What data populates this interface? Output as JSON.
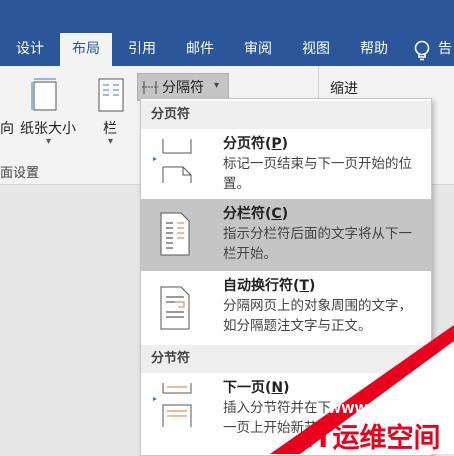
{
  "tabs": [
    "设计",
    "布局",
    "引用",
    "邮件",
    "审阅",
    "视图",
    "帮助",
    "告"
  ],
  "ribbon": {
    "orientation_partial": "向",
    "size": "纸张大小",
    "columns": "栏",
    "breaks_button": "分隔符",
    "indent": "缩进",
    "group_label": "面设置"
  },
  "menu": {
    "page_breaks_header": "分页符",
    "section_breaks_header": "分节符",
    "items": [
      {
        "title": "分页符(",
        "key": "P",
        "desc": "标记一页结束与下一页开始的位置。"
      },
      {
        "title": "分栏符(",
        "key": "C",
        "desc": "指示分栏符后面的文字将从下一栏开始。"
      },
      {
        "title": "自动换行符(",
        "key": "T",
        "desc": "分隔网页上的对象周围的文字，如分隔题注文字与正文。"
      },
      {
        "title": "下一页(",
        "key": "N",
        "desc": "插入分节符并在下一页上开始新节。"
      }
    ]
  },
  "watermark": {
    "url": "WWW.94IP.COM",
    "text": "IT运维空间"
  },
  "colors": {
    "ribbon_blue": "#2b579a",
    "hover": "#c5c5c5",
    "watermark_red": "#e8001c"
  }
}
